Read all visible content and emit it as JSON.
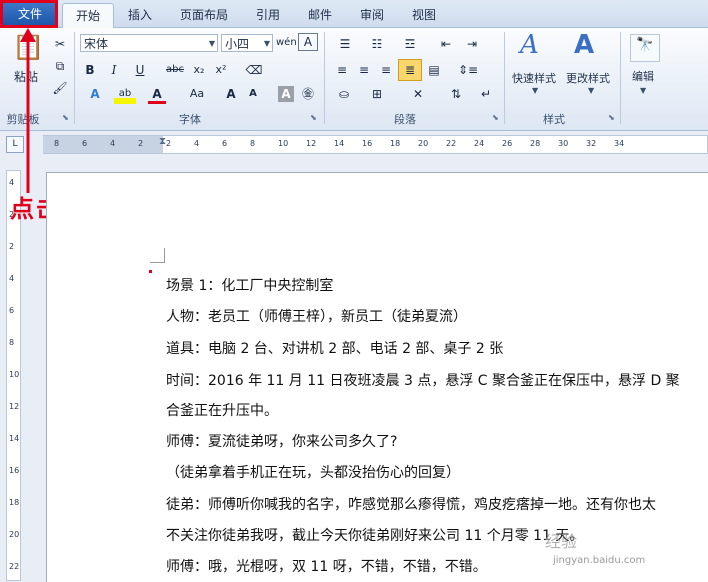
{
  "tabs": {
    "file": "文件",
    "home": "开始",
    "insert": "插入",
    "layout": "页面布局",
    "references": "引用",
    "mailings": "邮件",
    "review": "审阅",
    "view": "视图"
  },
  "ribbon": {
    "clipboard": {
      "paste": "粘贴",
      "label": "剪贴板"
    },
    "font": {
      "name": "宋体",
      "size": "小四",
      "label": "字体"
    },
    "paragraph": {
      "label": "段落"
    },
    "styles": {
      "quick": "快速样式",
      "change": "更改样式",
      "label": "样式"
    },
    "editing": {
      "label": "编辑"
    }
  },
  "annotation": "点击",
  "document": {
    "lines": [
      "场景 1：化工厂中央控制室",
      "人物：老员工（师傅王梓），新员工（徒弟夏流）",
      "道具：电脑 2 台、对讲机 2 部、电话 2 部、桌子 2 张",
      "时间：2016 年 11 月 11 日夜班凌晨 3 点，悬浮 C 聚合釜正在保压中，悬浮 D 聚",
      "合釜正在升压中。",
      "师傅：夏流徒弟呀，你来公司多久了?",
      "（徒弟拿着手机正在玩，头都没抬伤心的回复）",
      "徒弟：师傅听你喊我的名字，咋感觉那么瘆得慌，鸡皮疙瘩掉一地。还有你也太",
      "不关注你徒弟我呀，截止今天你徒弟刚好来公司 11 个月零 11 天。",
      "师傅：哦，光棍呀，双 11 呀，不错，不错，不错。"
    ]
  },
  "ruler_h": [
    "8",
    "6",
    "4",
    "2",
    "2",
    "4",
    "6",
    "8",
    "10",
    "12",
    "14",
    "16",
    "18",
    "20",
    "22",
    "24",
    "26",
    "28",
    "30",
    "32",
    "34"
  ],
  "ruler_v": [
    "4",
    "2",
    "2",
    "4",
    "6",
    "8",
    "10",
    "12",
    "14",
    "16",
    "18",
    "20",
    "22"
  ],
  "watermark": "经验",
  "watermark_url": "jingyan.baidu.com"
}
